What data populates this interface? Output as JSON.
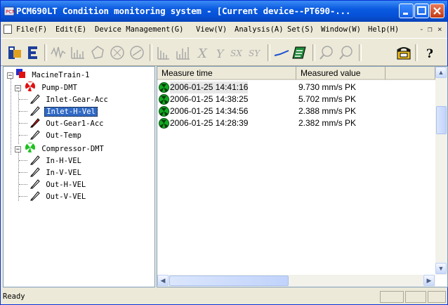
{
  "window": {
    "title": "PCM690LT Condition monitoring system  - [Current device--PT690-..."
  },
  "menu": {
    "items": [
      "File(F)",
      "Edit(E)",
      "Device Management(G)",
      "View(V)",
      "Analysis(A)",
      "Set(S)",
      "Window(W)",
      "Help(H)"
    ],
    "mdi_minimize": "-",
    "mdi_restore": "❐",
    "mdi_close": "×"
  },
  "toolbar": {
    "icons": [
      "tree-view-icon",
      "list-view-icon",
      "waveform-icon",
      "spectrum-icon",
      "orbit-icon",
      "polar-icon",
      "shaft-center-icon",
      "bar-trend-icon",
      "multi-bar-trend-icon",
      "x-axis-icon",
      "y-axis-icon",
      "sx-icon",
      "sy-icon",
      "trend-line-icon",
      "report-icon",
      "zoom-in-icon",
      "zoom-out-icon",
      "phone-alarm-icon",
      "help-icon"
    ],
    "labels": {
      "x": "X",
      "y": "Y",
      "sx": "SX",
      "sy": "SY",
      "help": "?"
    }
  },
  "tree": {
    "root": "MacineTrain-1",
    "machines": [
      {
        "name": "Pump-DMT",
        "status_color": "#e01010",
        "points": [
          "Inlet-Gear-Acc",
          "Inlet-H-Vel",
          "Out-Gear1-Acc",
          "Out-Temp"
        ]
      },
      {
        "name": "Compressor-DMT",
        "status_color": "#20c020",
        "points": [
          "In-H-VEL",
          "In-V-VEL",
          "Out-H-VEL",
          "Out-V-VEL"
        ]
      }
    ],
    "selected_point": "Inlet-H-Vel"
  },
  "list": {
    "columns": [
      "Measure time",
      "Measured value"
    ],
    "rows": [
      {
        "time": "2006-01-25 14:41:16",
        "value": "9.730 mm/s PK"
      },
      {
        "time": "2006-01-25 14:38:25",
        "value": "5.702 mm/s PK"
      },
      {
        "time": "2006-01-25 14:34:56",
        "value": "2.388 mm/s PK"
      },
      {
        "time": "2006-01-25 14:28:39",
        "value": "2.382 mm/s PK"
      }
    ]
  },
  "status": {
    "text": "Ready"
  }
}
